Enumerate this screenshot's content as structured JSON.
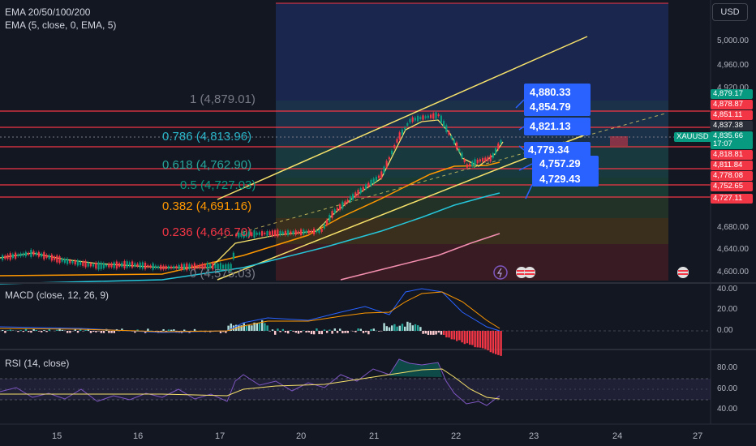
{
  "indicators": [
    "EMA 20/50/100/200",
    "EMA (5, close, 0, EMA, 5)"
  ],
  "currency": "USD",
  "price_axis": [
    "5,000.00",
    "4,960.00",
    "4,920.00",
    "4,680.00",
    "4,640.00",
    "4,600.00"
  ],
  "price_tags": [
    {
      "text": "4,879.17",
      "color": "#089981"
    },
    {
      "text": "4,878.87",
      "color": "#f23645"
    },
    {
      "text": "4,851.11",
      "color": "#f23645"
    },
    {
      "text": "4,837.38",
      "color": "#2a2e39"
    },
    {
      "text": "4,835.66",
      "color": "#089981"
    },
    {
      "text": "17:07",
      "color": "#089981"
    },
    {
      "text": "4,818.81",
      "color": "#f23645"
    },
    {
      "text": "4,811.84",
      "color": "#f23645"
    },
    {
      "text": "4,778.08",
      "color": "#f23645"
    },
    {
      "text": "4,752.65",
      "color": "#f23645"
    },
    {
      "text": "4,727.11",
      "color": "#f23645"
    }
  ],
  "symbol_tag": "XAUUSD",
  "fib_levels": [
    {
      "label": "1 (4,879.01)",
      "color": "#787b86"
    },
    {
      "label": "0.786 (4,813.96)",
      "color": "#2ab5c8"
    },
    {
      "label": "0.618 (4,762.90)",
      "color": "#26a69a"
    },
    {
      "label": "0.5 (4,727.03)",
      "color": "#089981"
    },
    {
      "label": "0.382 (4,691.16)",
      "color": "#ff9800"
    },
    {
      "label": "0.236 (4,646.70)",
      "color": "#f23645"
    },
    {
      "label": "0 (4,575.03)",
      "color": "#787b86"
    }
  ],
  "targets": [
    "4,880.33",
    "4,854.79",
    "4,821.13",
    "4,779.34",
    "4,757.29",
    "4,729.43"
  ],
  "macd": {
    "label": "MACD (close, 12, 26, 9)",
    "axis": [
      "40.00",
      "20.00",
      "0.00"
    ]
  },
  "rsi": {
    "label": "RSI (14, close)",
    "axis": [
      "80.00",
      "60.00",
      "40.00"
    ]
  },
  "dates": [
    "15",
    "16",
    "17",
    "20",
    "21",
    "22",
    "23",
    "24",
    "27"
  ],
  "colors": {
    "bg": "#131722",
    "up": "#089981",
    "down": "#f23645",
    "ema_yellow": "#f7e26b",
    "ema_orange": "#ff9800",
    "ema_cyan": "#26c6da",
    "ema_pink": "#f48fb1"
  }
}
